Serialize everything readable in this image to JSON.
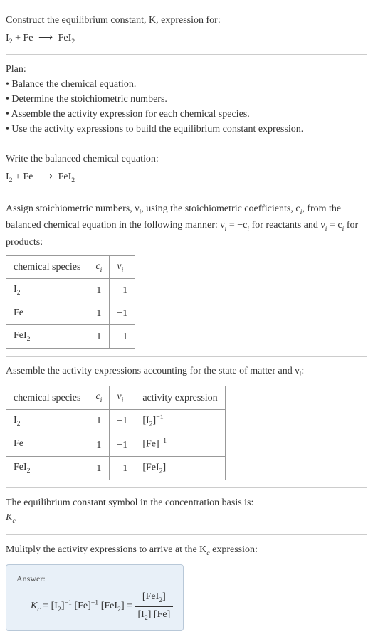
{
  "intro": {
    "line1": "Construct the equilibrium constant, K, expression for:",
    "equation_lhs1": "I",
    "equation_lhs1_sub": "2",
    "equation_plus": " + Fe ",
    "equation_arrow": "⟶",
    "equation_rhs": " FeI",
    "equation_rhs_sub": "2"
  },
  "plan": {
    "heading": "Plan:",
    "item1": "• Balance the chemical equation.",
    "item2": "• Determine the stoichiometric numbers.",
    "item3": "• Assemble the activity expression for each chemical species.",
    "item4": "• Use the activity expressions to build the equilibrium constant expression."
  },
  "balanced": {
    "text": "Write the balanced chemical equation:"
  },
  "stoich": {
    "text1": "Assign stoichiometric numbers, ν",
    "text1_sub": "i",
    "text2": ", using the stoichiometric coefficients, c",
    "text2_sub": "i",
    "text3": ", from the balanced chemical equation in the following manner: ν",
    "text3_sub": "i",
    "text4": " = −c",
    "text4_sub": "i",
    "text5": " for reactants and ν",
    "text5_sub": "i",
    "text6": " = c",
    "text6_sub": "i",
    "text7": " for products:",
    "table": {
      "headers": {
        "species": "chemical species",
        "ci": "c",
        "ci_sub": "i",
        "vi": "ν",
        "vi_sub": "i"
      },
      "rows": [
        {
          "species": "I",
          "species_sub": "2",
          "ci": "1",
          "vi": "−1"
        },
        {
          "species": "Fe",
          "species_sub": "",
          "ci": "1",
          "vi": "−1"
        },
        {
          "species": "FeI",
          "species_sub": "2",
          "ci": "1",
          "vi": "1"
        }
      ]
    }
  },
  "activity": {
    "text1": "Assemble the activity expressions accounting for the state of matter and ν",
    "text1_sub": "i",
    "text2": ":",
    "table": {
      "headers": {
        "species": "chemical species",
        "ci": "c",
        "ci_sub": "i",
        "vi": "ν",
        "vi_sub": "i",
        "activity": "activity expression"
      },
      "rows": [
        {
          "species": "I",
          "species_sub": "2",
          "ci": "1",
          "vi": "−1",
          "act_base": "[I",
          "act_sub": "2",
          "act_close": "]",
          "act_sup": "−1"
        },
        {
          "species": "Fe",
          "species_sub": "",
          "ci": "1",
          "vi": "−1",
          "act_base": "[Fe]",
          "act_sub": "",
          "act_close": "",
          "act_sup": "−1"
        },
        {
          "species": "FeI",
          "species_sub": "2",
          "ci": "1",
          "vi": "1",
          "act_base": "[FeI",
          "act_sub": "2",
          "act_close": "]",
          "act_sup": ""
        }
      ]
    }
  },
  "symbol": {
    "text": "The equilibrium constant symbol in the concentration basis is:",
    "kc": "K",
    "kc_sub": "c"
  },
  "multiply": {
    "text1": "Mulitply the activity expressions to arrive at the K",
    "text1_sub": "c",
    "text2": " expression:"
  },
  "answer": {
    "label": "Answer:",
    "kc": "K",
    "kc_sub": "c",
    "eq": " = [I",
    "i2_sub": "2",
    "i2_close": "]",
    "i2_sup": "−1",
    "fe": " [Fe]",
    "fe_sup": "−1",
    "fei2": " [FeI",
    "fei2_sub": "2",
    "fei2_close": "] = ",
    "frac_num1": "[FeI",
    "frac_num1_sub": "2",
    "frac_num1_close": "]",
    "frac_den1": "[I",
    "frac_den1_sub": "2",
    "frac_den1_close": "] [Fe]"
  }
}
